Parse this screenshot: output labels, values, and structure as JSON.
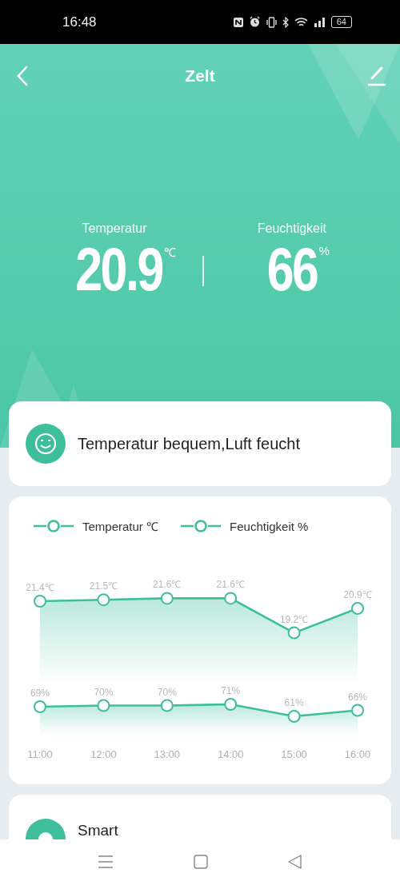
{
  "status_bar": {
    "time": "16:48",
    "battery": "64"
  },
  "header": {
    "title": "Zelt"
  },
  "readings": [
    {
      "label": "Temperatur",
      "value": "20.9",
      "unit": "℃"
    },
    {
      "label": "Feuchtigkeit",
      "value": "66",
      "unit": "%"
    }
  ],
  "comfort": {
    "message": "Temperatur bequem,Luft feucht"
  },
  "chart_card": {
    "temperature_chart": {
      "chart_data": {
        "type": "area",
        "data_labels": true,
        "series": [
          {
            "name": "Temperatur ℃",
            "color": "#3dbf9b",
            "marker": "circle",
            "values": [
              21.4,
              21.5,
              21.6,
              21.6,
              19.2,
              20.9
            ],
            "value_labels": [
              "21.4℃",
              "21.5℃",
              "21.6℃",
              "21.6℃",
              "19.2℃",
              "20.9℃"
            ]
          }
        ]
      }
    },
    "humidity_chart": {
      "chart_data": {
        "type": "area",
        "data_labels": true,
        "categories": [
          "11:00",
          "12:00",
          "13:00",
          "14:00",
          "15:00",
          "16:00"
        ],
        "series": [
          {
            "name": "Feuchtigkeit %",
            "color": "#3dbf9b",
            "marker": "circle",
            "values": [
              69,
              70,
              70,
              71,
              61,
              66
            ],
            "value_labels": [
              "69%",
              "70%",
              "70%",
              "71%",
              "61%",
              "66%"
            ]
          }
        ]
      }
    }
  },
  "smart_card": {
    "title": "Smart"
  }
}
